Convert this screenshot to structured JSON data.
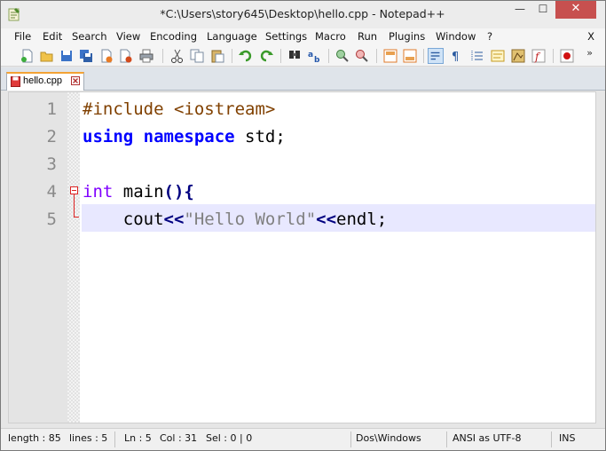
{
  "window": {
    "title": "*C:\\Users\\story645\\Desktop\\hello.cpp - Notepad++",
    "minimize_glyph": "—",
    "maximize_glyph": "☐",
    "close_glyph": "✕"
  },
  "menu": {
    "items": [
      {
        "label": "File"
      },
      {
        "label": "Edit"
      },
      {
        "label": "Search"
      },
      {
        "label": "View"
      },
      {
        "label": "Encoding"
      },
      {
        "label": "Language"
      },
      {
        "label": "Settings"
      },
      {
        "label": "Macro"
      },
      {
        "label": "Run"
      },
      {
        "label": "Plugins"
      },
      {
        "label": "Window"
      },
      {
        "label": "?"
      }
    ],
    "close_label": "X"
  },
  "toolbar": {
    "buttons": [
      {
        "name": "new-file-icon"
      },
      {
        "name": "open-file-icon"
      },
      {
        "name": "save-icon"
      },
      {
        "name": "save-all-icon"
      },
      {
        "name": "close-icon"
      },
      {
        "name": "close-all-icon"
      },
      {
        "name": "print-icon"
      },
      {
        "name": "cut-icon"
      },
      {
        "name": "copy-icon"
      },
      {
        "name": "paste-icon"
      },
      {
        "name": "undo-icon"
      },
      {
        "name": "redo-icon"
      },
      {
        "name": "find-icon"
      },
      {
        "name": "replace-icon"
      },
      {
        "name": "zoom-in-icon"
      },
      {
        "name": "zoom-out-icon"
      },
      {
        "name": "sync-vertical-icon"
      },
      {
        "name": "sync-horizontal-icon"
      },
      {
        "name": "word-wrap-icon"
      },
      {
        "name": "show-all-chars-icon"
      },
      {
        "name": "indent-guide-icon"
      },
      {
        "name": "user-language-icon"
      },
      {
        "name": "doc-map-icon"
      },
      {
        "name": "function-list-icon"
      },
      {
        "name": "record-macro-icon"
      }
    ],
    "more_glyph": "»"
  },
  "tabs": [
    {
      "label": "hello.cpp"
    }
  ],
  "editor": {
    "line_numbers": [
      "1",
      "2",
      "3",
      "4",
      "5"
    ],
    "lines": {
      "l1": {
        "prep": "#include <iostream>"
      },
      "l2": {
        "kw1": "using",
        "sp1": " ",
        "kw2": "namespace",
        "rest": " std;"
      },
      "l3": {},
      "l4": {
        "type": "int",
        "name": " main",
        "paren": "()",
        "brace": "{"
      },
      "l5": {
        "indent": "    ",
        "cout": "cout",
        "op1": "<<",
        "str": "\"Hello World\"",
        "op2": "<<",
        "endl": "endl;"
      }
    }
  },
  "statusbar": {
    "length": "length : 85",
    "lines": "lines : 5",
    "ln": "Ln : 5",
    "col": "Col : 31",
    "sel": "Sel : 0 | 0",
    "eol": "Dos\\Windows",
    "encoding": "ANSI as UTF-8",
    "mode": "INS"
  }
}
